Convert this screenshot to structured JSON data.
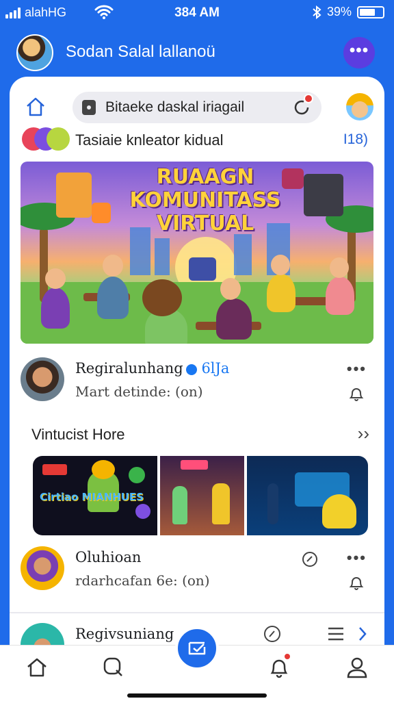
{
  "status_bar": {
    "carrier": "alahHG",
    "time": "384 AM",
    "battery": "39%"
  },
  "header": {
    "title": "Sodan Salal lallanoü",
    "more_label": "•••"
  },
  "toolbar": {
    "search_text": "Bitaeke daskal iriagail"
  },
  "section_top": {
    "title": "Tasiaie knleator kidual",
    "count": "I18)"
  },
  "banner": {
    "title": "RUAAGN KOMUNITASS VIRTUAL"
  },
  "posts": [
    {
      "name": "Regiralunhang",
      "verified_tag": "6lJa",
      "subtitle": "Mart detinde: (on)",
      "more": "•••"
    },
    {
      "name": "Oluhioan",
      "subtitle": "rdarhcafan 6e: (on)",
      "more": "•••"
    },
    {
      "name": "Regivsuniang"
    }
  ],
  "section_mid": {
    "title": "Vintucist Hore",
    "chevron": "››"
  },
  "strip": {
    "tile1_text": "Cirtiao MIANHUES"
  },
  "colors": {
    "brand_blue": "#1f6bea",
    "accent_purple": "#5b3de0",
    "badge_red": "#e53935"
  },
  "icons": [
    "signal-icon",
    "wifi-icon",
    "bluetooth-icon",
    "battery-icon",
    "more-icon",
    "home-icon",
    "lock-icon",
    "refresh-icon",
    "bell-icon",
    "search-icon",
    "compose-icon",
    "notification-icon",
    "profile-icon"
  ]
}
